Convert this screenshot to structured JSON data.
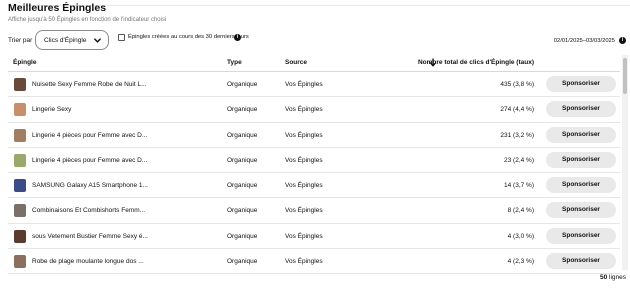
{
  "header": {
    "title": "Meilleures Épingles",
    "subtitle": "Affiche jusqu'à 50 Épingles en fonction de l'indicateur choisi"
  },
  "filters": {
    "sort_label": "Trier par",
    "sort_value": "Clics d'Épingle",
    "checkbox_label": "Épingles créées au cours des 30 derniers jours",
    "checkbox_checked": false,
    "date_range": "02/01/2025–03/03/2025"
  },
  "table": {
    "columns": {
      "pin": "Épingle",
      "type": "Type",
      "source": "Source",
      "clicks": "Nombre total de clics d'Épingle (taux)"
    },
    "rows": [
      {
        "name": "Nuisette Sexy Femme Robe de Nuit L...",
        "type": "Organique",
        "source": "Vos Épingles",
        "clicks": "435 (3,8 %)",
        "action": "Sponsoriser",
        "thumb_color": "#6b4a3a"
      },
      {
        "name": "Lingerie Sexy",
        "type": "Organique",
        "source": "Vos Épingles",
        "clicks": "274 (4,4 %)",
        "action": "Sponsoriser",
        "thumb_color": "#c98f6a"
      },
      {
        "name": "Lingerie 4 pièces pour Femme avec D...",
        "type": "Organique",
        "source": "Vos Épingles",
        "clicks": "231 (3,2 %)",
        "action": "Sponsoriser",
        "thumb_color": "#a37d5f"
      },
      {
        "name": "Lingerie 4 pièces pour Femme avec D...",
        "type": "Organique",
        "source": "Vos Épingles",
        "clicks": "23 (2,4 %)",
        "action": "Sponsoriser",
        "thumb_color": "#9aa86a"
      },
      {
        "name": "SAMSUNG Galaxy A15 Smartphone 1...",
        "type": "Organique",
        "source": "Vos Épingles",
        "clicks": "14 (3,7 %)",
        "action": "Sponsoriser",
        "thumb_color": "#3b4a8a"
      },
      {
        "name": "Combinaisons Et Combishorts Femm...",
        "type": "Organique",
        "source": "Vos Épingles",
        "clicks": "8 (2,4 %)",
        "action": "Sponsoriser",
        "thumb_color": "#7b6f6a"
      },
      {
        "name": "sous Vetement Bustier Femme Sexy é...",
        "type": "Organique",
        "source": "Vos Épingles",
        "clicks": "4 (3,0 %)",
        "action": "Sponsoriser",
        "thumb_color": "#5a3b2e"
      },
      {
        "name": "Robe de plage moulante longue dos ...",
        "type": "Organique",
        "source": "Vos Épingles",
        "clicks": "4 (2,3 %)",
        "action": "Sponsoriser",
        "thumb_color": "#8c6f5e"
      }
    ]
  },
  "footer": {
    "row_count_number": "50",
    "row_count_unit": "lignes"
  }
}
